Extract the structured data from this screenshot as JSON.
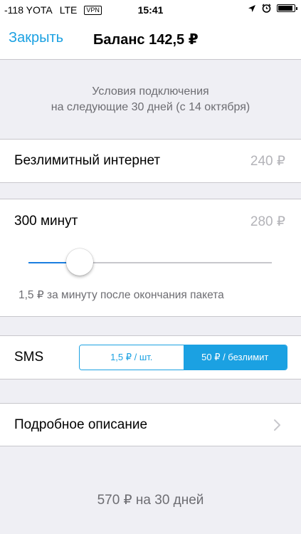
{
  "status_bar": {
    "signal": "-118",
    "carrier": "YOTA",
    "network": "LTE",
    "vpn": "VPN",
    "time": "15:41",
    "icons": [
      "location-arrow-icon",
      "alarm-clock-icon",
      "battery-icon"
    ],
    "battery_level": 0.9
  },
  "nav": {
    "close_label": "Закрыть",
    "title": "Баланс 142,5 ₽"
  },
  "conditions": {
    "line1": "Условия подключения",
    "line2": "на следующие 30 дней (с 14 октября)"
  },
  "internet": {
    "label": "Безлимитный интернет",
    "price": "240 ₽"
  },
  "minutes": {
    "label": "300 минут",
    "price": "280 ₽",
    "slider_level": 0.21,
    "note": "1,5 ₽ за минуту после окончания пакета"
  },
  "sms": {
    "label": "SMS",
    "options": [
      "1,5 ₽ / шт.",
      "50 ₽ / безлимит"
    ],
    "selected": "50 ₽ / безлимит"
  },
  "details": {
    "label": "Подробное описание",
    "icon": "chevron-right-icon"
  },
  "total": {
    "text": "570 ₽ на 30 дней"
  },
  "colors": {
    "accent": "#1ba1e2",
    "slider_fill": "#1b7ee0",
    "background": "#efeff4"
  }
}
